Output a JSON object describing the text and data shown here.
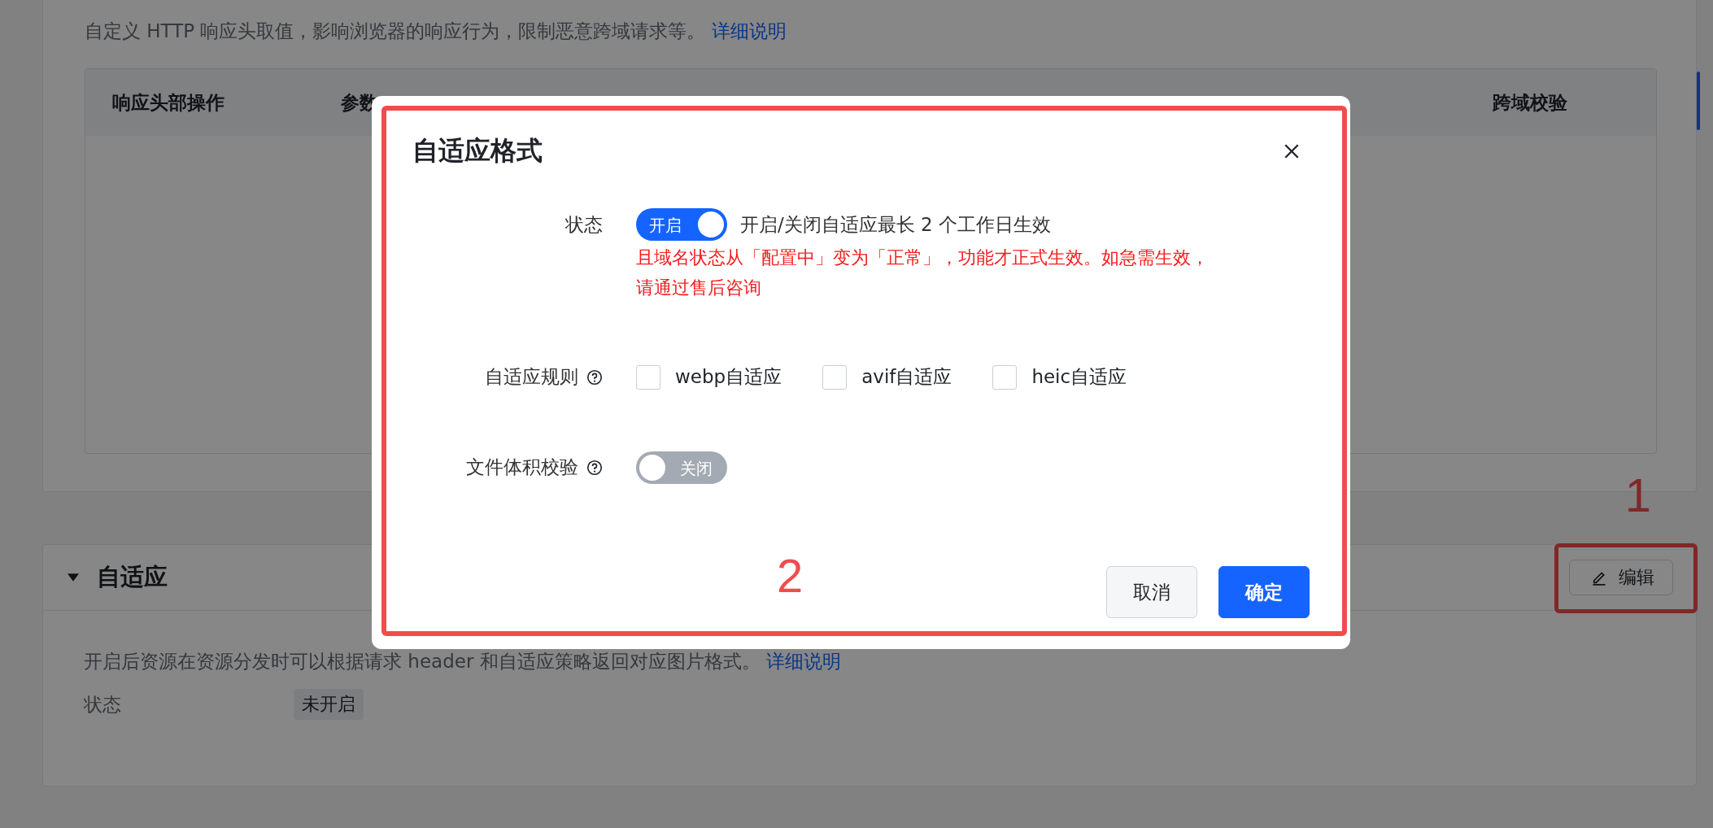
{
  "headers_section": {
    "description": "自定义 HTTP 响应头取值，影响浏览器的响应行为，限制恶意跨域请求等。",
    "link": "详细说明",
    "table": {
      "columns": [
        "响应头部操作",
        "参数",
        "跨域校验"
      ]
    }
  },
  "adaptive_section": {
    "title": "自适应",
    "expanded": true,
    "edit_button": "编辑",
    "description": "开启后资源在资源分发时可以根据请求 header 和自适应策略返回对应图片格式。",
    "link": "详细说明",
    "status_label": "状态",
    "status_value": "未开启"
  },
  "dialog": {
    "title": "自适应格式",
    "fields": [
      {
        "kind": "switch",
        "label": "状态",
        "help": false,
        "on": true,
        "switch_text": "开启",
        "hint": "开启/关闭自适应最长 2 个工作日生效",
        "warning": [
          "且域名状态从「配置中」变为「正常」，功能才正式生效。如急需生效，",
          "请通过售后咨询"
        ]
      },
      {
        "kind": "checkboxes",
        "label": "自适应规则",
        "help": true,
        "options": [
          {
            "label": "webp自适应",
            "checked": false
          },
          {
            "label": "avif自适应",
            "checked": false
          },
          {
            "label": "heic自适应",
            "checked": false
          }
        ]
      },
      {
        "kind": "switch",
        "label": "文件体积校验",
        "help": true,
        "on": false,
        "switch_text": "关闭"
      }
    ],
    "buttons": [
      {
        "label": "取消",
        "primary": false
      },
      {
        "label": "确定",
        "primary": true
      }
    ]
  },
  "annotations": [
    {
      "text": "1"
    },
    {
      "text": "2"
    }
  ]
}
